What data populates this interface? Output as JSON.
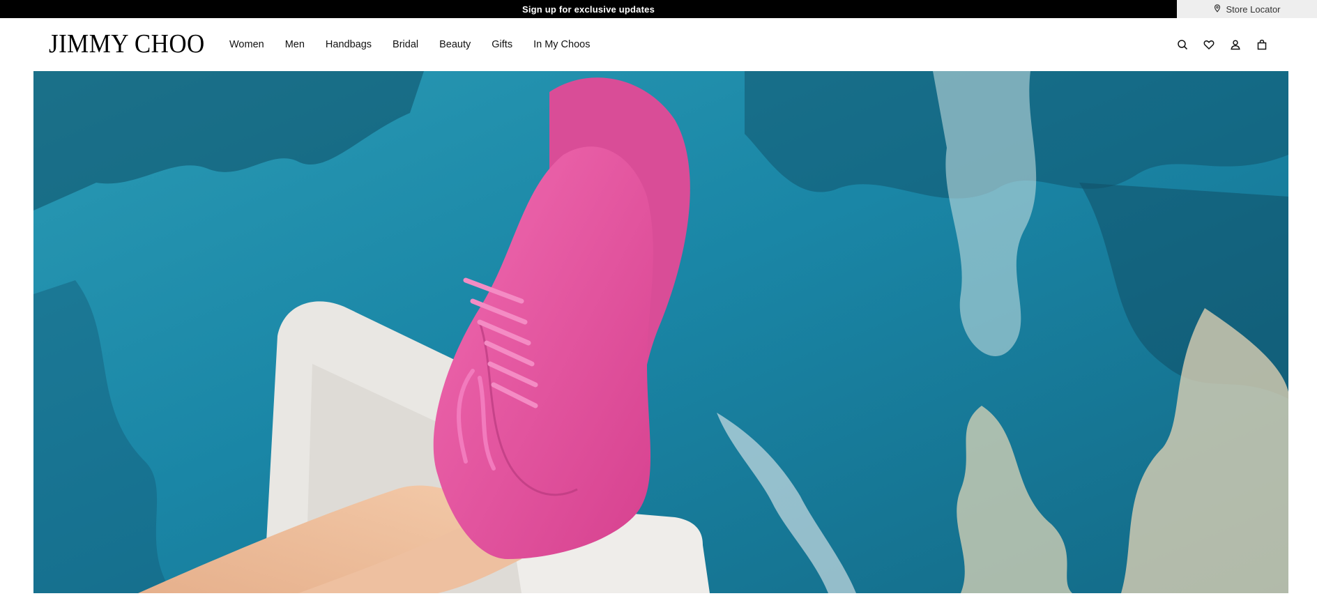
{
  "promo_bar": {
    "text": "Sign up for exclusive updates"
  },
  "store_locator": {
    "label": "Store Locator",
    "icon": "location-pin-icon"
  },
  "header": {
    "logo": "JIMMY CHOO",
    "nav": [
      "Women",
      "Men",
      "Handbags",
      "Bridal",
      "Beauty",
      "Gifts",
      "In My Choos"
    ],
    "icons": [
      "search-icon",
      "heart-icon",
      "account-icon",
      "bag-icon"
    ]
  },
  "hero": {
    "description_colors": {
      "pool": "#1d87a6",
      "sneaker": "#e04f9e",
      "ledge": "#e8e6e2"
    }
  }
}
